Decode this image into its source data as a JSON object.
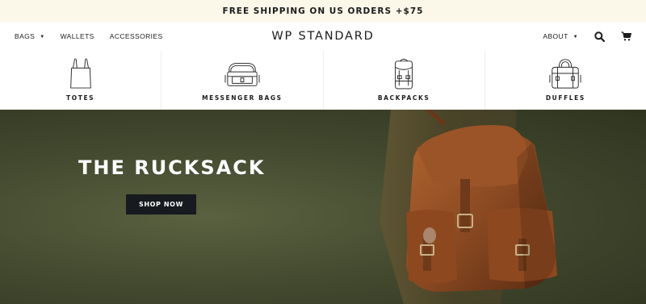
{
  "promo": {
    "text": "FREE SHIPPING ON US ORDERS +$75"
  },
  "header": {
    "logo": "WP STANDARD",
    "nav_left": [
      {
        "label": "BAGS",
        "has_dropdown": true
      },
      {
        "label": "WALLETS",
        "has_dropdown": false
      },
      {
        "label": "ACCESSORIES",
        "has_dropdown": false
      }
    ],
    "about": {
      "label": "ABOUT",
      "has_dropdown": true
    },
    "icons": [
      "search-icon",
      "cart-icon"
    ]
  },
  "categories": [
    {
      "label": "TOTES",
      "icon": "tote-bag-icon"
    },
    {
      "label": "MESSENGER BAGS",
      "icon": "messenger-bag-icon"
    },
    {
      "label": "BACKPACKS",
      "icon": "backpack-icon"
    },
    {
      "label": "DUFFLES",
      "icon": "duffle-bag-icon"
    }
  ],
  "hero": {
    "title": "THE RUCKSACK",
    "cta": "SHOP NOW"
  },
  "colors": {
    "promo_bg": "#fbf8ea",
    "hero_bg": "#444a2f",
    "cta_bg": "#171a1f",
    "leather": "#8b4a22",
    "text": "#1c1c1c"
  }
}
